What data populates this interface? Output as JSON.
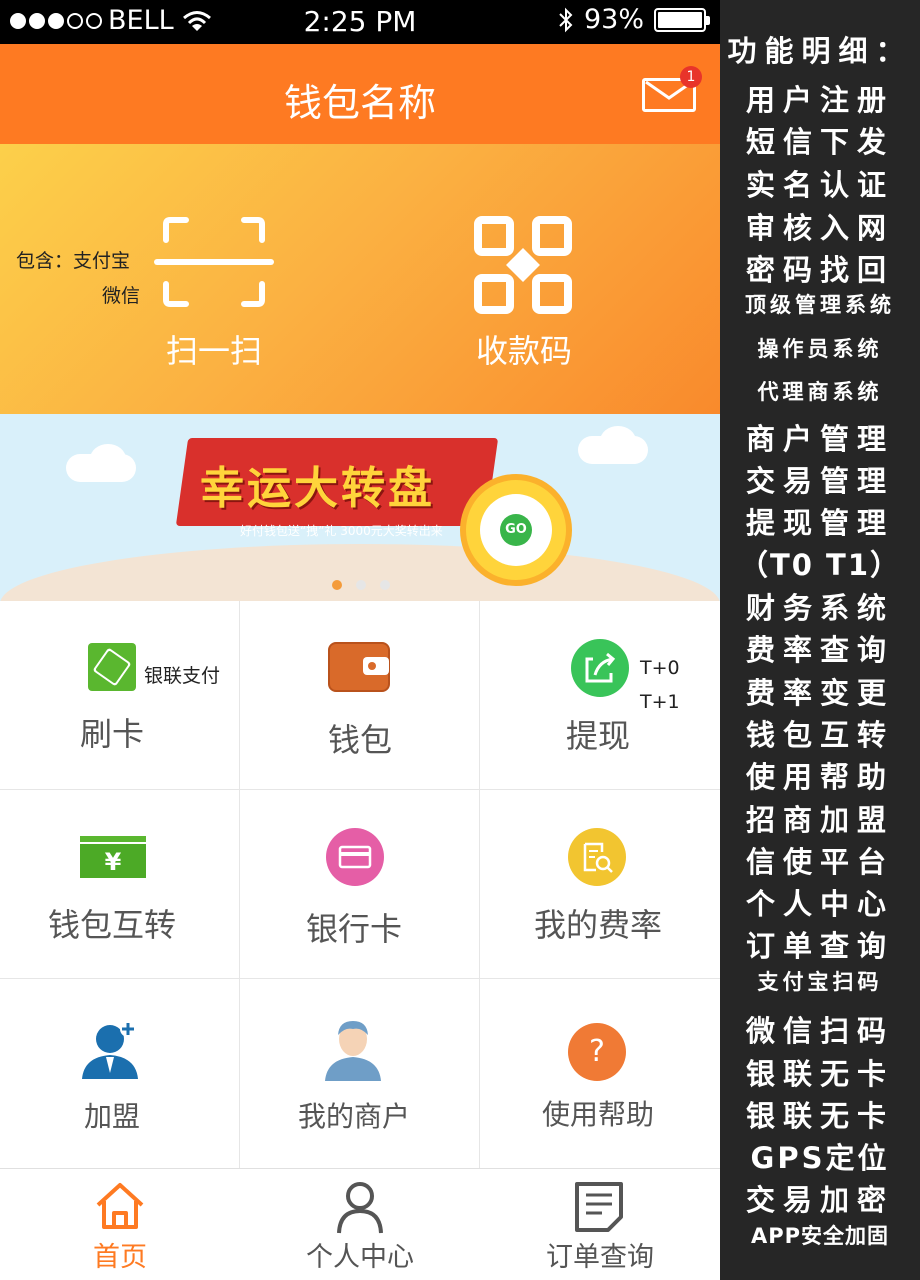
{
  "status_bar": {
    "carrier": "BELL",
    "time": "2:25 PM",
    "battery": "93%"
  },
  "header": {
    "title": "钱包名称",
    "mail_badge": "1"
  },
  "hero": {
    "note_line1": "包含：支付宝",
    "note_line2": "微信",
    "scan_label": "扫一扫",
    "qrcode_label": "收款码"
  },
  "banner": {
    "title": "幸运大转盘",
    "subtitle": "好付钱包送“拽”礼 3000元大奖转出来",
    "go": "GO"
  },
  "grid": {
    "swipe": {
      "label": "刷卡",
      "note": "银联支付"
    },
    "wallet": {
      "label": "钱包"
    },
    "withdraw": {
      "label": "提现",
      "note1": "T+0",
      "note2": "T+1"
    },
    "transfer": {
      "label": "钱包互转"
    },
    "bankcard": {
      "label": "银行卡"
    },
    "rate": {
      "label": "我的费率"
    },
    "join": {
      "label": "加盟"
    },
    "merchants": {
      "label": "我的商户"
    },
    "help": {
      "label": "使用帮助",
      "glyph": "?"
    }
  },
  "tabs": [
    {
      "label": "首页",
      "active": true
    },
    {
      "label": "个人中心",
      "active": false
    },
    {
      "label": "订单查询",
      "active": false
    }
  ],
  "features": [
    "功能明细：",
    "用户注册",
    "短信下发",
    "实名认证",
    "审核入网",
    "密码找回",
    "顶级管理系统",
    "操作员系统",
    "代理商系统",
    "商户管理",
    "交易管理",
    "提现管理",
    "（T0 T1）",
    "财务系统",
    "费率查询",
    "费率变更",
    "钱包互转",
    "使用帮助",
    "招商加盟",
    "信使平台",
    "个人中心",
    "订单查询",
    "支付宝扫码",
    "微信扫码",
    "银联无卡",
    "银联无卡",
    "GPS定位",
    "交易加密",
    "APP安全加固"
  ],
  "colors": {
    "orange": "#fe7a22",
    "dark_panel": "#262626",
    "green": "#5ab72f",
    "pink": "#e55ea6",
    "yellow": "#f2c530"
  }
}
